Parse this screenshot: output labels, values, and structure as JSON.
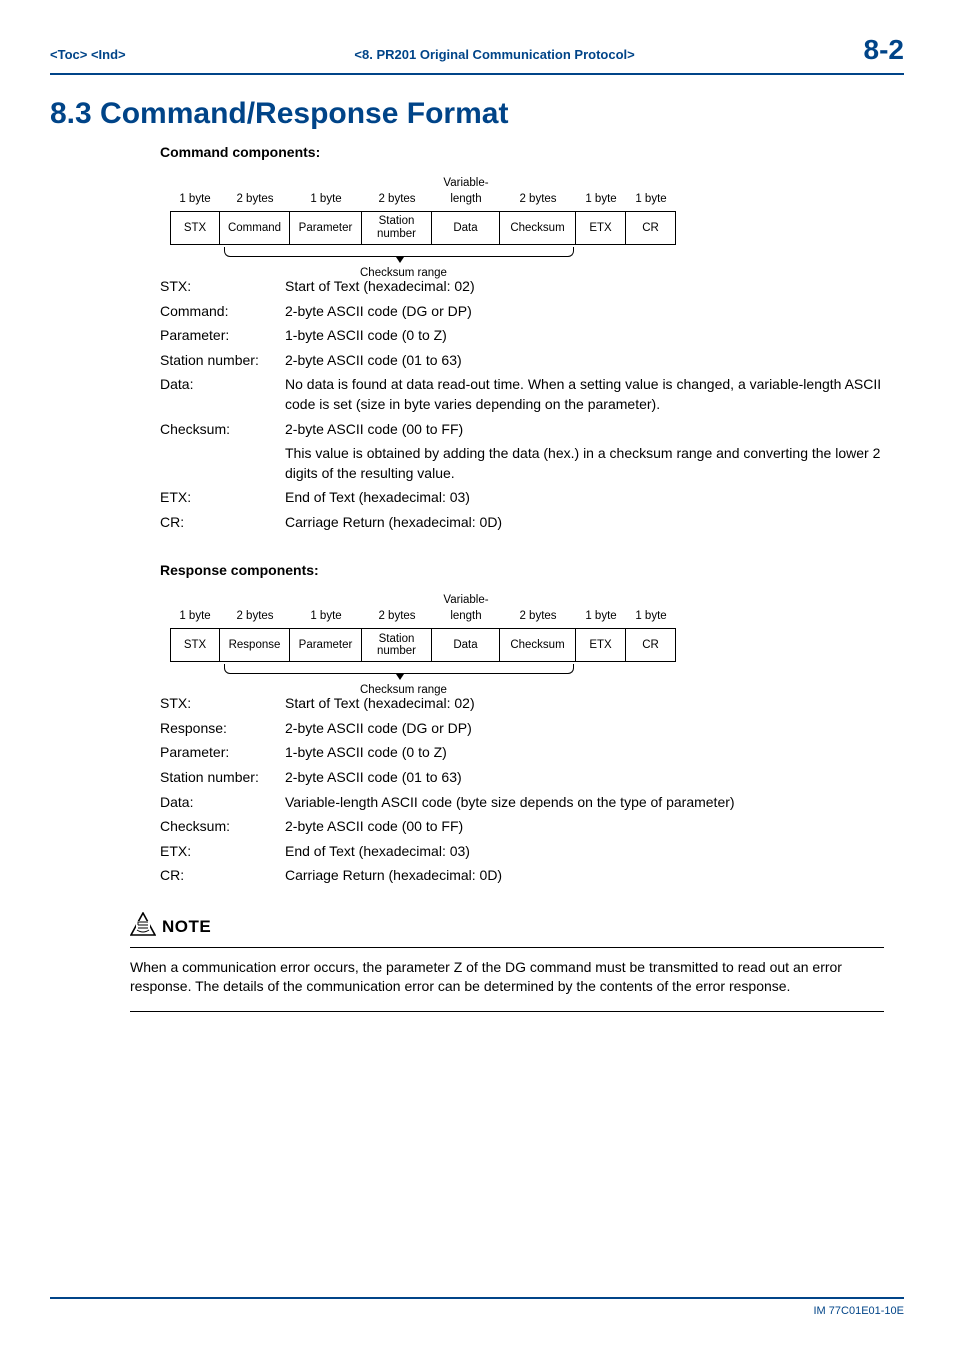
{
  "header": {
    "left": "<Toc> <Ind>",
    "mid": "<8.  PR201 Original Communication Protocol>",
    "right": "8-2"
  },
  "heading": "8.3    Command/Response Format",
  "cmd": {
    "title": "Command components:",
    "sizes": [
      "1 byte",
      "2 bytes",
      "1 byte",
      "2 bytes",
      "Variable-\nlength",
      "2 bytes",
      "1 byte",
      "1 byte"
    ],
    "cells": [
      "STX",
      "Command",
      "Parameter",
      "Station\nnumber",
      "Data",
      "Checksum",
      "ETX",
      "CR"
    ],
    "bracket_label": "Checksum range",
    "defs": [
      [
        "STX:",
        "Start of Text (hexadecimal: 02)"
      ],
      [
        "Command:",
        "2-byte ASCII code (DG or DP)"
      ],
      [
        "Parameter:",
        "1-byte ASCII code (0 to Z)"
      ],
      [
        "Station number:",
        "2-byte ASCII code (01 to 63)"
      ],
      [
        "Data:",
        "No data is found at data read-out time. When a setting value is changed, a variable-length ASCII code is set (size in byte varies depending on the parameter)."
      ],
      [
        "Checksum:",
        "2-byte ASCII code (00 to FF)"
      ],
      [
        "",
        "This value is obtained by adding the data (hex.) in a checksum range and converting the lower 2 digits of the resulting value."
      ],
      [
        "ETX:",
        "End of Text (hexadecimal: 03)"
      ],
      [
        "CR:",
        "Carriage Return (hexadecimal: 0D)"
      ]
    ]
  },
  "rsp": {
    "title": "Response components:",
    "sizes": [
      "1 byte",
      "2 bytes",
      "1 byte",
      "2 bytes",
      "Variable-\nlength",
      "2 bytes",
      "1 byte",
      "1 byte"
    ],
    "cells": [
      "STX",
      "Response",
      "Parameter",
      "Station\nnumber",
      "Data",
      "Checksum",
      "ETX",
      "CR"
    ],
    "bracket_label": "Checksum range",
    "defs": [
      [
        "STX:",
        "Start of Text (hexadecimal: 02)"
      ],
      [
        "Response:",
        "2-byte ASCII code (DG or DP)"
      ],
      [
        "Parameter:",
        "1-byte ASCII code (0 to Z)"
      ],
      [
        "Station number:",
        "2-byte ASCII code (01 to 63)"
      ],
      [
        "Data:",
        "Variable-length ASCII code (byte size depends on the type of parameter)"
      ],
      [
        "Checksum:",
        "2-byte ASCII code (00 to FF)"
      ],
      [
        "ETX:",
        "End of Text (hexadecimal: 03)"
      ],
      [
        "CR:",
        "Carriage Return (hexadecimal: 0D)"
      ]
    ]
  },
  "note": {
    "title": "NOTE",
    "body": "When a communication error occurs, the parameter Z of the DG command must be transmitted to read out an error response. The details of the communication error can be determined by the contents of the error response."
  },
  "footer": "IM 77C01E01-10E"
}
